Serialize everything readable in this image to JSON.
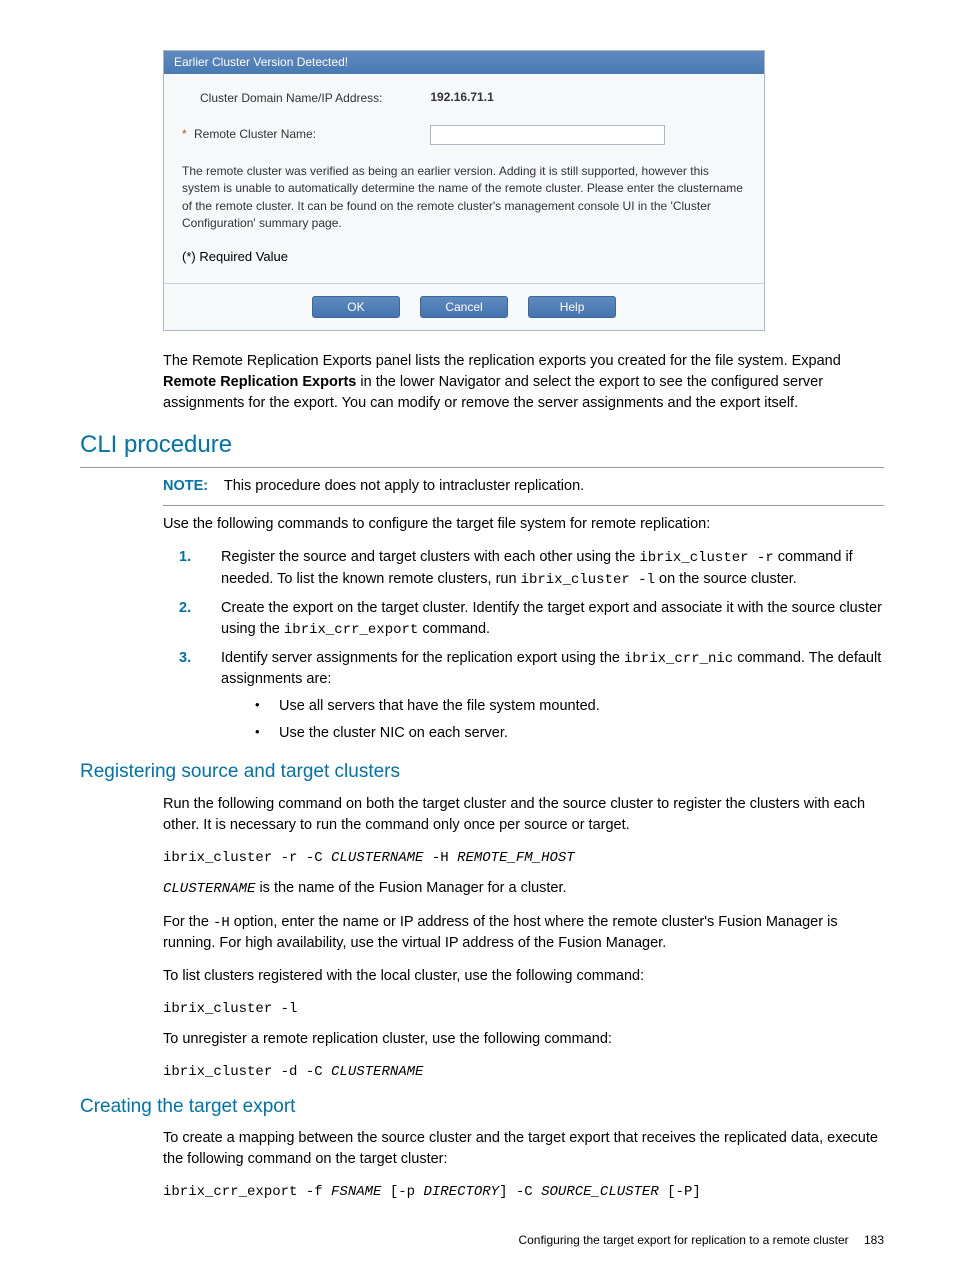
{
  "dialog": {
    "title": "Earlier Cluster Version Detected!",
    "row1_label": "Cluster Domain Name/IP Address:",
    "row1_value": "192.16.71.1",
    "asterisk": "*",
    "row2_label": "Remote Cluster Name:",
    "info": "The remote cluster was verified as being an earlier version. Adding it is still supported, however this system is unable to automatically determine the name of the remote cluster. Please enter the clustername of the remote cluster. It can be found on the remote cluster's management console UI in the 'Cluster Configuration' summary page.",
    "required": "(*) Required Value",
    "ok": "OK",
    "cancel": "Cancel",
    "help": "Help"
  },
  "p1a": "The Remote Replication Exports panel lists the replication exports you created for the file system. Expand ",
  "p1b": "Remote Replication Exports",
  "p1c": " in the lower Navigator and select the export to see the configured server assignments for the export. You can modify or remove the server assignments and the export itself.",
  "h2": "CLI procedure",
  "note_label": "NOTE:",
  "note_text": "This procedure does not apply to intracluster replication.",
  "p2": "Use the following commands to configure the target file system for remote replication:",
  "ol": {
    "n1": "1.",
    "t1a": "Register the source and target clusters with each other using the ",
    "t1b": "ibrix_cluster -r",
    "t1c": " command if needed. To list the known remote clusters, run ",
    "t1d": "ibrix_cluster -l",
    "t1e": " on the source cluster.",
    "n2": "2.",
    "t2a": "Create the export on the target cluster. Identify the target export and associate it with the source cluster using the ",
    "t2b": "ibrix_crr_export",
    "t2c": " command.",
    "n3": "3.",
    "t3a": "Identify server assignments for the replication export using the ",
    "t3b": "ibrix_crr_nic",
    "t3c": " command. The default assignments are:",
    "b1": "Use all servers that have the file system mounted.",
    "b2": "Use the cluster NIC on each server."
  },
  "h3a": "Registering source and target clusters",
  "reg": {
    "p1": "Run the following command on both the target cluster and the source cluster to register the clusters with each other. It is necessary to run the command only once per source or target.",
    "cmd1a": "ibrix_cluster -r -C ",
    "cmd1b": "CLUSTERNAME",
    "cmd1c": " -H ",
    "cmd1d": "REMOTE_FM_HOST",
    "p2a": "CLUSTERNAME",
    "p2b": " is the name of the Fusion Manager for a cluster.",
    "p3a": "For the ",
    "p3b": "-H",
    "p3c": " option, enter the name or IP address of the host where the remote cluster's Fusion Manager is running. For high availability, use the virtual IP address of the Fusion Manager.",
    "p4": "To list clusters registered with the local cluster, use the following command:",
    "cmd2": "ibrix_cluster -l",
    "p5": "To unregister a remote replication cluster, use the following command:",
    "cmd3a": "ibrix_cluster -d -C ",
    "cmd3b": "CLUSTERNAME"
  },
  "h3b": "Creating the target export",
  "cte": {
    "p1": "To create a mapping between the source cluster and the target export that receives the replicated data, execute the following command on the target cluster:",
    "cmd_a": "ibrix_crr_export -f ",
    "cmd_b": "FSNAME",
    "cmd_c": " [-p ",
    "cmd_d": "DIRECTORY",
    "cmd_e": "] -C ",
    "cmd_f": "SOURCE_CLUSTER",
    "cmd_g": " [-P]"
  },
  "footer_text": "Configuring the target export for replication to a remote cluster",
  "footer_page": "183"
}
